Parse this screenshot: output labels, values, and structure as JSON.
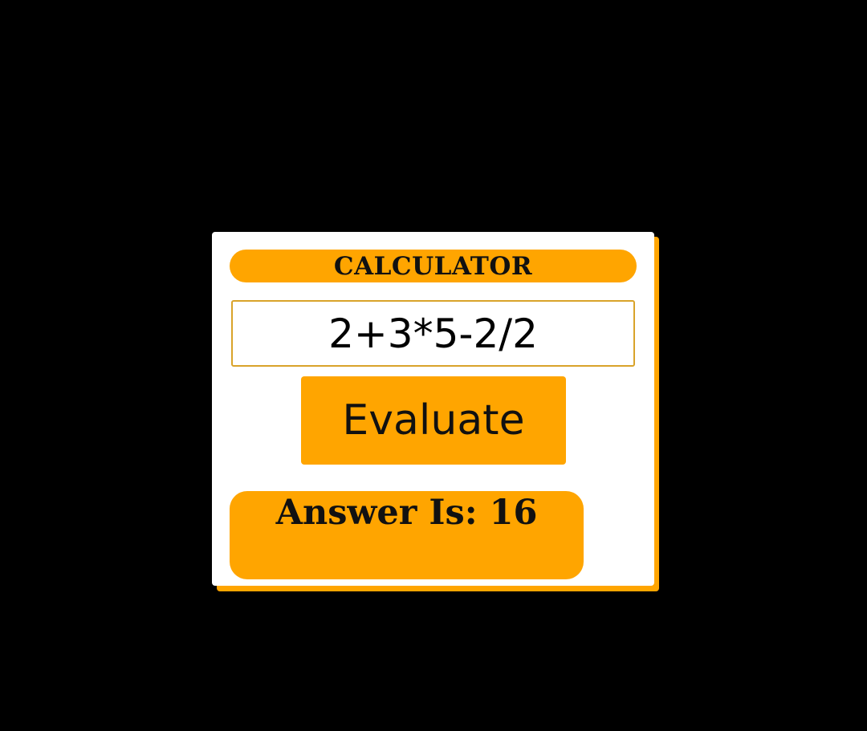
{
  "calculator": {
    "title": "CALCULATOR",
    "expression_value": "2+3*5-2/2",
    "evaluate_label": "Evaluate",
    "answer_text": "Answer Is: 16"
  },
  "colors": {
    "background": "#000000",
    "card": "#ffffff",
    "accent": "#ffa500"
  }
}
